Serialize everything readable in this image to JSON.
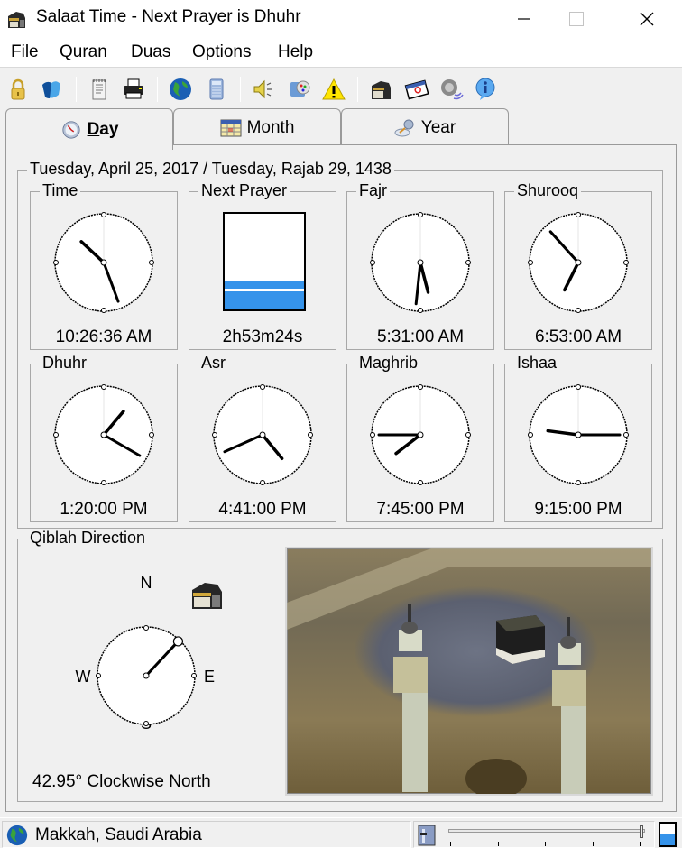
{
  "window": {
    "title": "Salaat Time - Next Prayer is Dhuhr",
    "controls": {
      "minimize": "minimize",
      "maximize": "maximize",
      "close": "close"
    }
  },
  "menu": [
    "File",
    "Quran",
    "Duas",
    "Options",
    "Help"
  ],
  "toolbar": {
    "icons": [
      "lock-icon",
      "shield-icon",
      "notepad-icon",
      "printer-icon",
      "globe-icon",
      "calculator-icon",
      "speaker-icon",
      "palette-icon",
      "warning-icon",
      "kaaba-icon",
      "calendar-icon",
      "volume-knob-icon",
      "info-icon"
    ]
  },
  "tabs": [
    {
      "label": "Day",
      "underline_char": "D",
      "rest": "ay",
      "active": true,
      "icon": "clock-icon"
    },
    {
      "label": "Month",
      "underline_char": "M",
      "rest": "onth",
      "active": false,
      "icon": "calendar-grid-icon"
    },
    {
      "label": "Year",
      "underline_char": "Y",
      "rest": "ear",
      "active": false,
      "icon": "satellite-icon"
    }
  ],
  "day": {
    "date_header": "Tuesday, April 25, 2017 / Tuesday, Rajab 29, 1438",
    "current_time": {
      "label": "Time",
      "value": "10:26:36 AM"
    },
    "next_prayer": {
      "label": "Next Prayer",
      "value": "2h53m24s",
      "progress_fraction": 0.3,
      "accent": "#3593ea"
    },
    "prayers": [
      {
        "label": "Fajr",
        "value": "5:31:00 AM"
      },
      {
        "label": "Shurooq",
        "value": "6:53:00 AM"
      },
      {
        "label": "Dhuhr",
        "value": "1:20:00 PM"
      },
      {
        "label": "Asr",
        "value": "4:41:00 PM"
      },
      {
        "label": "Maghrib",
        "value": "7:45:00 PM"
      },
      {
        "label": "Ishaa",
        "value": "9:15:00 PM"
      }
    ]
  },
  "qiblah": {
    "label": "Qiblah Direction",
    "angle_deg": 42.95,
    "readout": "42.95° Clockwise North",
    "compass": {
      "n": "N",
      "e": "E",
      "s": "S",
      "w": "W"
    },
    "image_alt": "Masjid al-Haram with the Kaaba and minarets"
  },
  "status": {
    "location": "Makkah, Saudi Arabia",
    "volume_fraction": 1.0,
    "level_fraction": 0.5
  }
}
